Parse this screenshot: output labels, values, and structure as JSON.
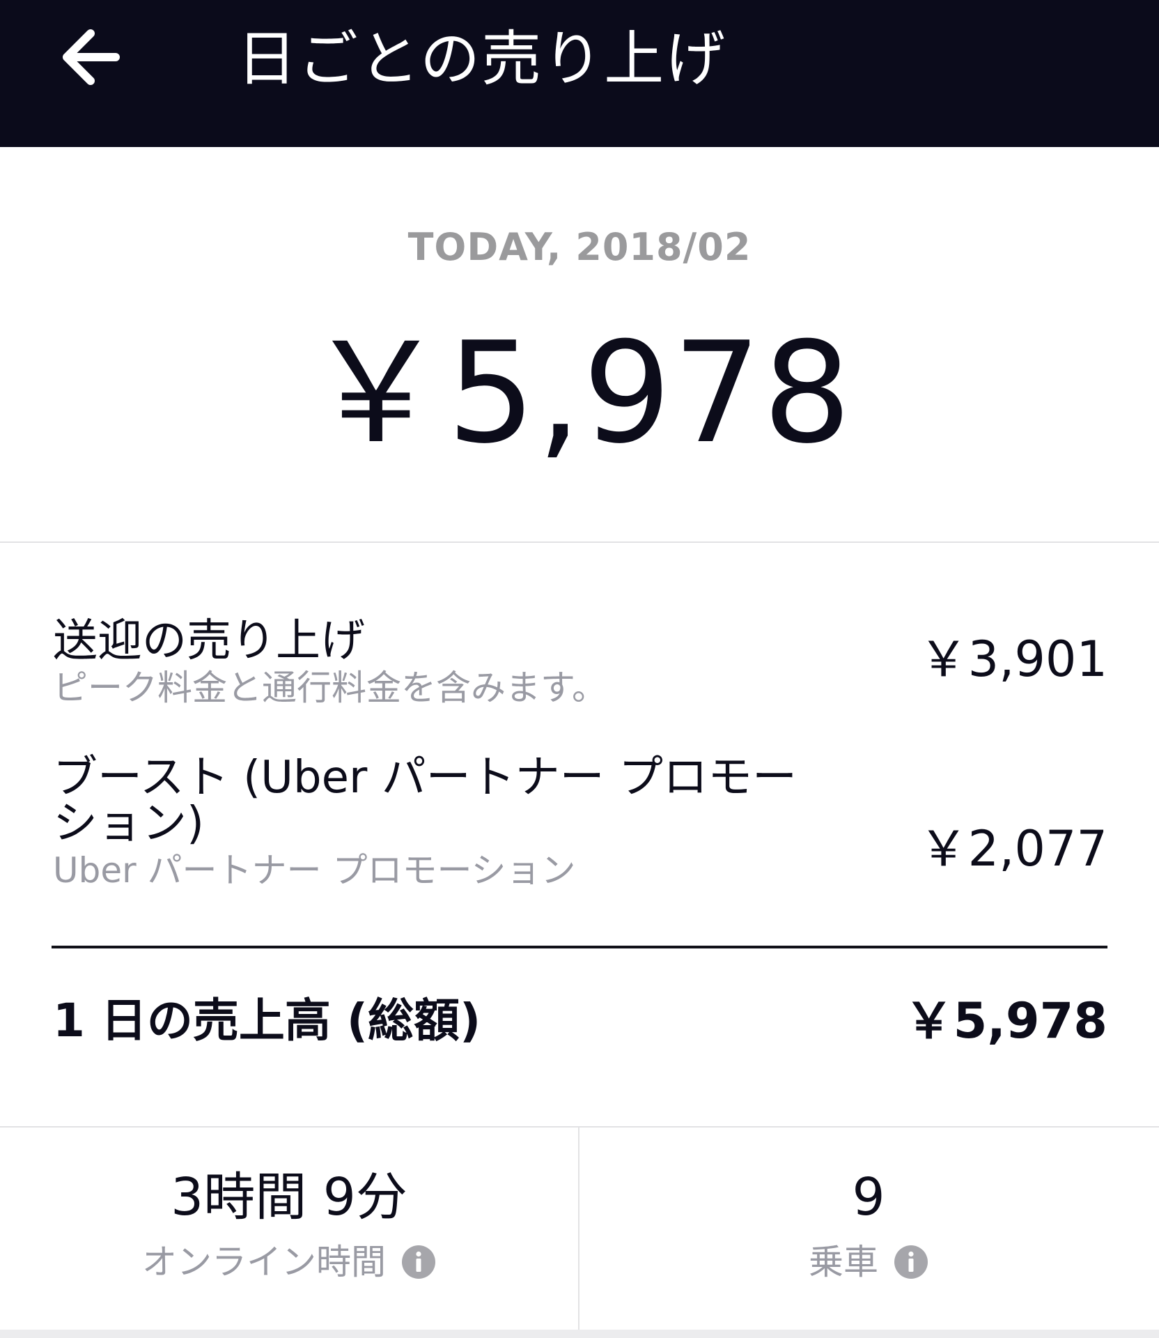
{
  "header": {
    "title": "日ごとの売り上げ"
  },
  "summary": {
    "date_label": "TODAY, 2018/02",
    "total_amount": "￥5,978"
  },
  "breakdown": {
    "items": [
      {
        "title": "送迎の売り上げ",
        "subtitle": "ピーク料金と通行料金を含みます。",
        "amount": "￥3,901"
      },
      {
        "title_line1": "ブースト (Uber パートナー プロモー",
        "title_line2": "ション)",
        "subtitle": "Uber パートナー プロモーション",
        "amount": "￥2,077"
      }
    ],
    "total_label": "1 日の売上高 (総額)",
    "total_value": "￥5,978"
  },
  "stats": {
    "online_time": {
      "value": "3時間 9分",
      "label": "オンライン時間"
    },
    "trips": {
      "value": "9",
      "label": "乗車"
    }
  },
  "colors": {
    "header_bg": "#0b0b1b",
    "secondary_text": "#999aa3",
    "date_label": "#9a9a9c",
    "info_icon": "#a6a6ab"
  }
}
